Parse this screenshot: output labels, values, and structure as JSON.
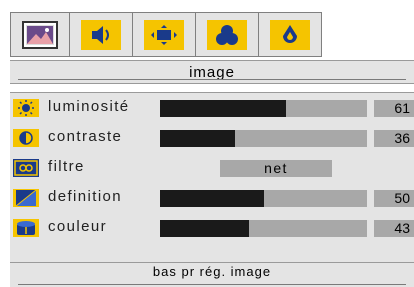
{
  "tabs": [
    {
      "icon": "image-icon",
      "active": true
    },
    {
      "icon": "speaker-icon",
      "active": false
    },
    {
      "icon": "screen-position-icon",
      "active": false
    },
    {
      "icon": "color-circles-icon",
      "active": false
    },
    {
      "icon": "settings-drop-icon",
      "active": false
    }
  ],
  "section_title": "image",
  "rows": [
    {
      "label": "luminosité",
      "value": "61",
      "level": 0.61,
      "icon": "brightness-icon"
    },
    {
      "label": "contraste",
      "value": "36",
      "level": 0.36,
      "icon": "contrast-icon"
    },
    {
      "label": "filtre",
      "option": "net",
      "icon": "filter-icon"
    },
    {
      "label": "definition",
      "value": "50",
      "level": 0.5,
      "icon": "sharpness-icon"
    },
    {
      "label": "couleur",
      "value": "43",
      "level": 0.43,
      "icon": "color-icon"
    }
  ],
  "footer_label": "bas pr rég. image",
  "colors": {
    "accent": "#f5c400",
    "fill": "#1a1a1a",
    "track": "#a8a8a8",
    "panel": "#e4e4e4"
  }
}
